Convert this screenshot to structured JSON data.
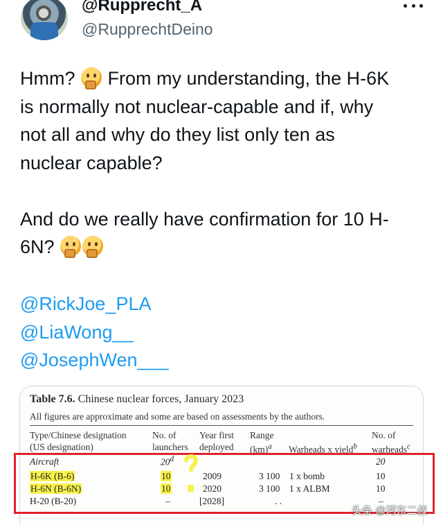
{
  "author": {
    "display_name": "@Rupprecht_A",
    "handle": "@RupprechtDeino"
  },
  "tweet": {
    "lines": [
      {
        "text": "Hmm? ",
        "emoji_after": "thinking-face",
        "text2": " From my understanding, the H-6K"
      },
      {
        "text": "is normally not nuclear-capable and if, why"
      },
      {
        "text": "not all and why do they list only ten as"
      },
      {
        "text": "nuclear capable?"
      },
      {
        "text": "And do we really have confirmation for 10 H-"
      },
      {
        "text": "6N? "
      }
    ],
    "emojis": [
      "thinking-face",
      "thinking-face",
      "thinking-face"
    ],
    "mentions": [
      "@RickJoe_PLA",
      "@LiaWong__",
      "@JosephWen___"
    ]
  },
  "table_image": {
    "title_bold": "Table 7.6.",
    "title_rest": " Chinese nuclear forces, January 2023",
    "subtitle": "All figures are approximate and some are based on assessments by the authors.",
    "headers": {
      "type_1": "Type/Chinese designation",
      "type_2": "(US designation)",
      "launchers_1": "No. of",
      "launchers_2": "launchers",
      "year_1": "Year first",
      "year_2": "deployed",
      "range_1": "Range",
      "range_2": "(km)",
      "range_sup": "a",
      "warheads_yield": "Warheads x yield",
      "warheads_yield_sup": "b",
      "count_1": "No. of",
      "count_2": "warheads",
      "count_sup": "c"
    },
    "rows": [
      {
        "type": "Aircraft",
        "launchers": "20",
        "launchers_sup": "d",
        "year": "",
        "range": "",
        "warheads": "",
        "count": "20"
      },
      {
        "type": "H-6K (B-6)",
        "launchers": "10",
        "year": "2009",
        "range": "3 100",
        "warheads": "1 x bomb",
        "count": "10"
      },
      {
        "type": "H-6N (B-6N)",
        "launchers": "10",
        "year": "2020",
        "range": "3 100",
        "warheads": "1 x ALBM",
        "count": "10"
      },
      {
        "type": "H-20 (B-20)",
        "launchers": "–",
        "year": "[2028]",
        "range": ". .",
        "warheads": "",
        "count": "–"
      }
    ],
    "annotation_mark": "?"
  },
  "watermark": "头条 @河东二叔",
  "colors": {
    "text": "#0f1419",
    "secondary": "#536471",
    "link": "#1d9bf0",
    "highlight": "#f7f24a",
    "annotation_box": "#e0222c"
  }
}
